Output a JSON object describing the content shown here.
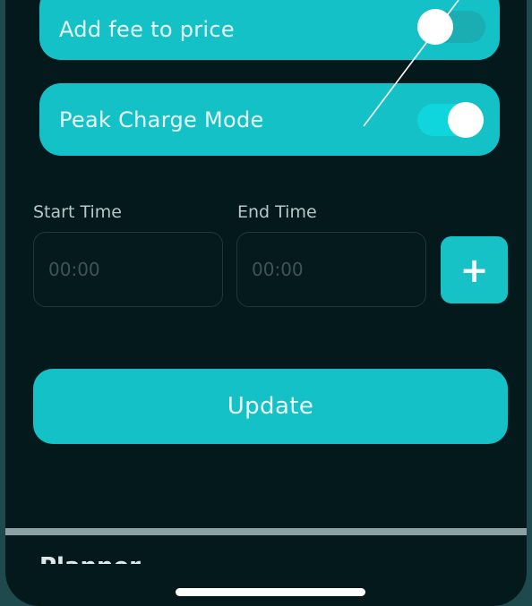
{
  "settings": {
    "add_fee": {
      "label": "Add fee to price",
      "enabled": false
    },
    "peak_charge": {
      "label": "Peak Charge Mode",
      "enabled": true
    }
  },
  "schedule": {
    "start_label": "Start Time",
    "start_placeholder": "00:00",
    "end_label": "End Time",
    "end_placeholder": "00:00",
    "add_label": "+"
  },
  "update_label": "Update",
  "next_section_label": "Planner",
  "colors": {
    "accent": "#14c1c6",
    "background": "#04191b",
    "bezel": "#1f4a4d"
  }
}
